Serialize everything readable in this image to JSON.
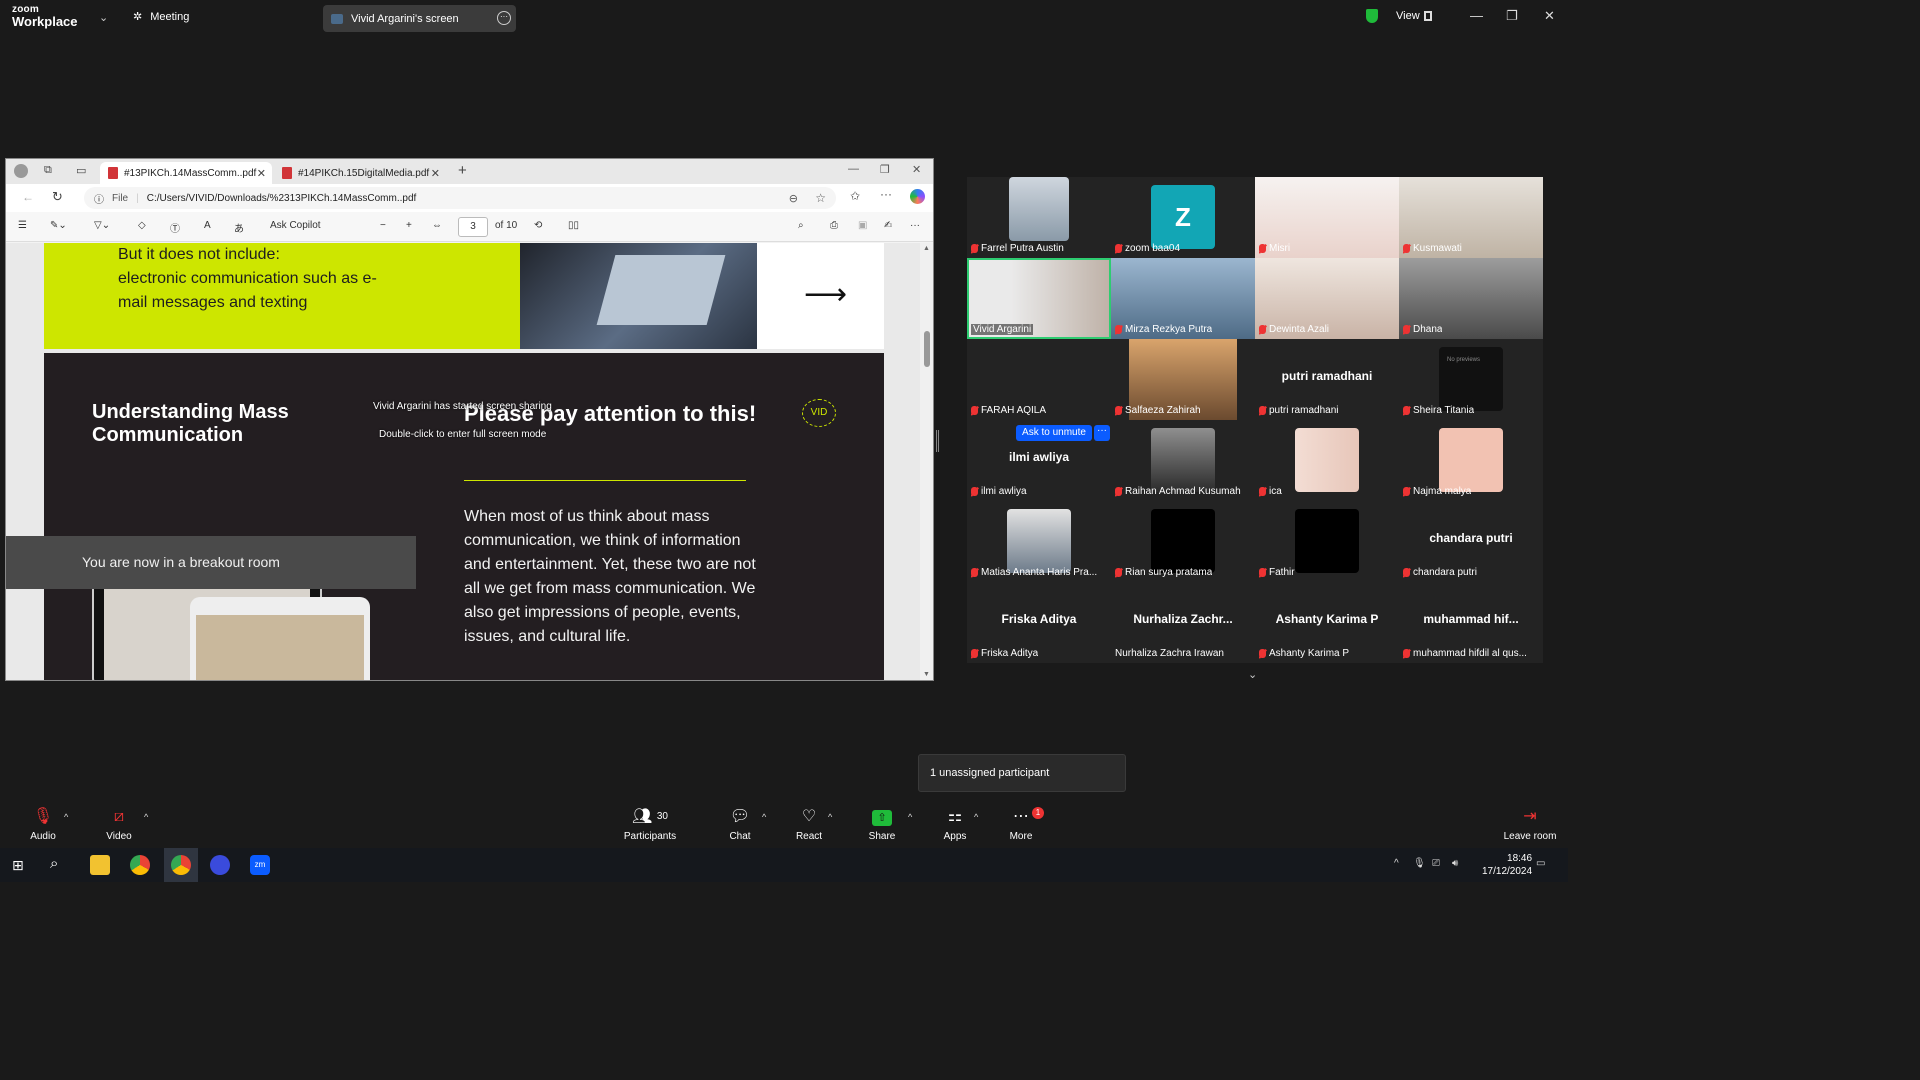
{
  "app": {
    "brand_top": "zoom",
    "brand_bottom": "Workplace",
    "meeting_label": "Meeting",
    "share_title": "Vivid Argarini's screen",
    "view_label": "View",
    "accent": "#0b5cff",
    "secure_color": "#1fbb3a"
  },
  "browser": {
    "tabs": [
      {
        "label": "#13PIKCh.14MassComm..pdf",
        "active": true
      },
      {
        "label": "#14PIKCh.15DigitalMedia.pdf",
        "active": false
      }
    ],
    "file_label": "File",
    "url": "C:/Users/VIVID/Downloads/%2313PIKCh.14MassComm..pdf",
    "ask_copilot": "Ask Copilot",
    "page_current": "3",
    "page_total": "of 10"
  },
  "slide": {
    "top_text_1": "But it does not include:",
    "top_text_2": "electronic communication such as e-",
    "top_text_3": "mail messages and texting",
    "arrow": "⟶",
    "title": "Understanding Mass Communication",
    "heading": "Please pay attention to this!",
    "badge": "VID",
    "body": "When most of us think about mass communication, we think of information and entertainment. Yet, these two are not all we get from mass communication. We also get impressions of people, events, issues, and cultural life.",
    "accent": "#cde600"
  },
  "overlays": {
    "screen_share_started": "Vivid Argarini has started screen sharing",
    "fullscreen_hint": "Double-click to enter full screen mode",
    "breakout": "You are now in a breakout room"
  },
  "participants": [
    {
      "name": "Farrel Putra Austin",
      "type": "video"
    },
    {
      "name": "zoom baa04",
      "type": "avatar",
      "initial": "Z"
    },
    {
      "name": "Misri",
      "type": "video"
    },
    {
      "name": "Kusmawati",
      "type": "video"
    },
    {
      "name": "Vivid Argarini",
      "type": "video",
      "speaking": true
    },
    {
      "name": "Mirza Rezkya Putra",
      "type": "video"
    },
    {
      "name": "Dewinta Azali",
      "type": "video"
    },
    {
      "name": "Dhana",
      "type": "video"
    },
    {
      "name": "FARAH AQILA",
      "type": "blank"
    },
    {
      "name": "Salfaeza Zahirah",
      "type": "photo"
    },
    {
      "name": "putri ramadhani",
      "type": "name",
      "big": "putri ramadhani"
    },
    {
      "name": "Sheira Titania",
      "type": "photo",
      "overlay": "No previews"
    },
    {
      "name": "ilmi awliya",
      "type": "name",
      "big": "ilmi awliya"
    },
    {
      "name": "Raihan Achmad Kusumah",
      "type": "photo"
    },
    {
      "name": "ica",
      "type": "photo"
    },
    {
      "name": "Najma malya",
      "type": "photo"
    },
    {
      "name": "Matias Ananta Haris Pra...",
      "type": "photo"
    },
    {
      "name": "Rian surya pratama",
      "type": "black"
    },
    {
      "name": "Fathir",
      "type": "black"
    },
    {
      "name": "chandara putri",
      "type": "name",
      "big": "chandara putri"
    },
    {
      "name": "Friska Aditya",
      "type": "name",
      "big": "Friska Aditya"
    },
    {
      "name": "Nurhaliza Zachra Irawan",
      "type": "name",
      "big": "Nurhaliza  Zachr..."
    },
    {
      "name": "Ashanty Karima P",
      "type": "name",
      "big": "Ashanty Karima P"
    },
    {
      "name": "muhammad hifdil al qus...",
      "type": "name",
      "big": "muhammad  hif..."
    }
  ],
  "gallery": {
    "ask_to_unmute": "Ask to unmute",
    "unmute_more": "···"
  },
  "toast": "1 unassigned participant",
  "controls": {
    "audio": "Audio",
    "video": "Video",
    "participants": "Participants",
    "participants_count": "30",
    "chat": "Chat",
    "react": "React",
    "share": "Share",
    "apps": "Apps",
    "more": "More",
    "more_badge": "1",
    "leave": "Leave room"
  },
  "taskbar": {
    "time": "18:46",
    "date": "17/12/2024"
  }
}
